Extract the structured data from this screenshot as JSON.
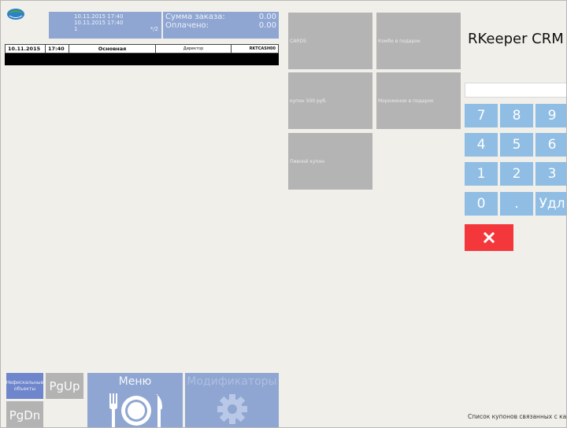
{
  "header": {
    "order_date1": "10.11.2015 17:40",
    "order_date2": "10.11.2015 17:40",
    "order_num": "1",
    "order_guests": "*/2",
    "sum_label": "Сумма заказа:",
    "sum_value": "0.00",
    "paid_label": "Оплачено:",
    "paid_value": "0.00"
  },
  "info_bar": {
    "date": "10.11.2015",
    "time": "17:40",
    "table": "Основная",
    "role": "Директор",
    "station": "RKTCASH00"
  },
  "bottom_buttons": {
    "nonfiscal": "Нефискальные объекты",
    "pgup": "PgUp",
    "pgdn": "PgDn",
    "menu": "Меню",
    "modifiers": "Модификаторы"
  },
  "tiles": [
    "CARDS",
    "Комбо в подарок",
    "купон 500 руб.",
    "Мороженое в подарок",
    "Пивной купон"
  ],
  "crm": {
    "title": "RKeeper CRM",
    "input_value": "",
    "keys": [
      "7",
      "8",
      "9",
      "4",
      "5",
      "6",
      "1",
      "2",
      "3",
      "0",
      ".",
      "Удл"
    ],
    "footer": "Список купонов связанных с ка"
  },
  "colors": {
    "accent_blue": "#8fa6d2",
    "key_blue": "#8fbde3",
    "cancel_red": "#f4373a",
    "tile_gray": "#b4b4b4"
  }
}
